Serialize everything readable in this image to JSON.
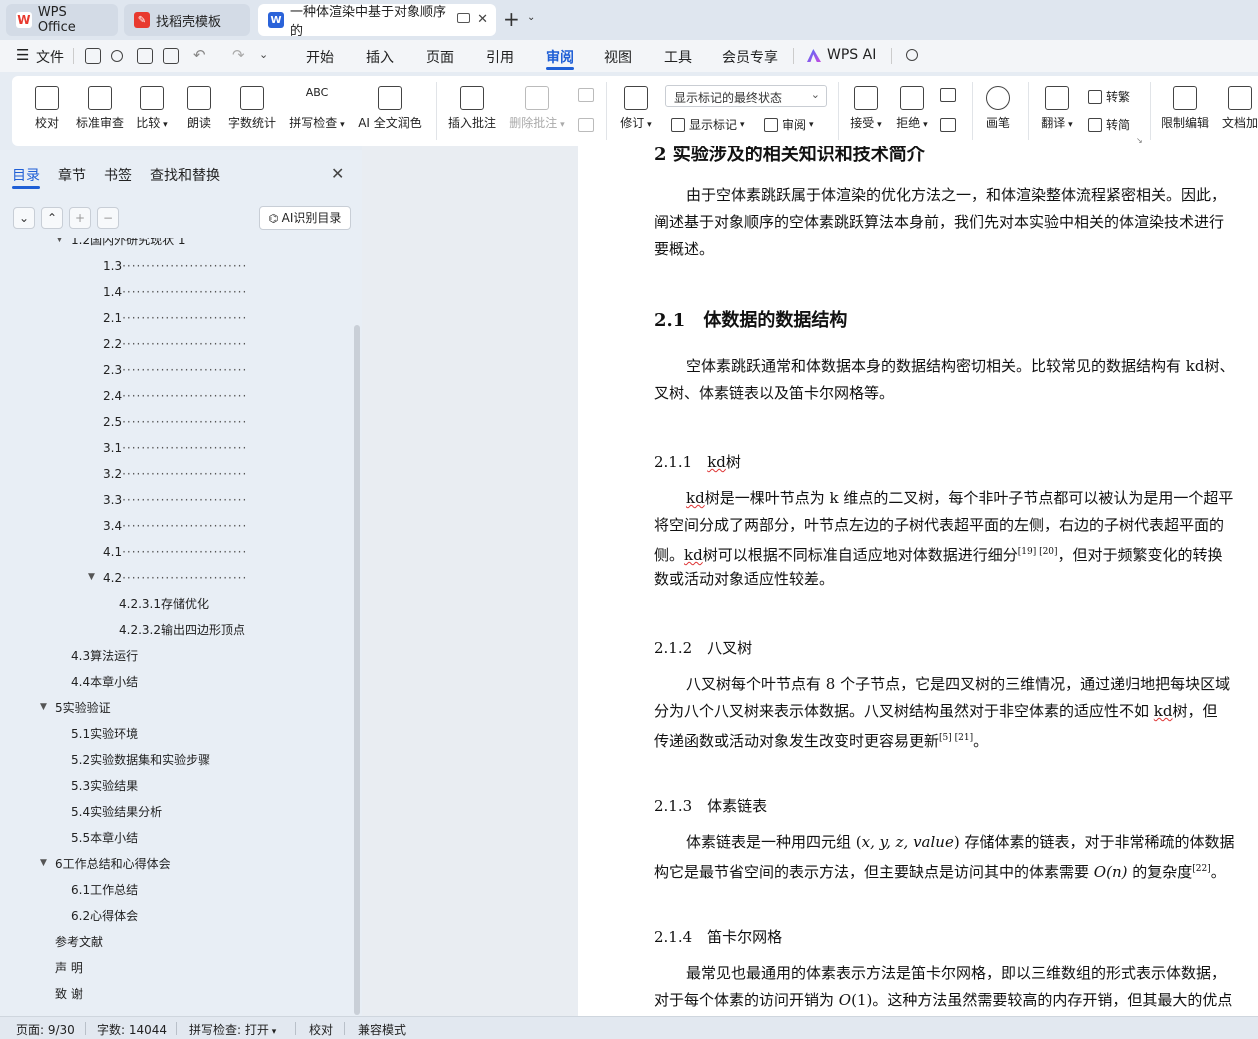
{
  "tabs": [
    {
      "label": "WPS Office",
      "icon": "wps-logo-icon",
      "color": "#e8392e"
    },
    {
      "label": "找稻壳模板",
      "icon": "docer-icon",
      "color": "#e8392e"
    },
    {
      "label": "一种体渲染中基于对象顺序的",
      "icon": "word-doc-icon",
      "color": "#2b63d9"
    }
  ],
  "new_tab": "+",
  "menu": {
    "file": "文件",
    "items": [
      "开始",
      "插入",
      "页面",
      "引用",
      "审阅",
      "视图",
      "工具",
      "会员专享"
    ],
    "active": "审阅",
    "wps_ai": "WPS AI"
  },
  "ribbon": {
    "buttons": [
      "校对",
      "标准审查",
      "比较",
      "朗读",
      "字数统计",
      "拼写检查",
      "AI 全文润色",
      "插入批注",
      "删除批注",
      "修订",
      "接受",
      "拒绝",
      "画笔",
      "翻译",
      "限制编辑",
      "文档加"
    ],
    "dropdown_value": "显示标记的最终状态",
    "show_markup": "显示标记",
    "review": "审阅",
    "to_traditional": "转繁",
    "to_simplified": "转简"
  },
  "panel": {
    "tabs": [
      "目录",
      "章节",
      "书签",
      "查找和替换"
    ],
    "active_tab": "目录",
    "ai_button": "AI识别目录"
  },
  "toc": [
    {
      "text": "1.2国内外研究现状 1",
      "level": 2,
      "arrow": true
    },
    {
      "text": "1.3",
      "level": 3,
      "dots": true
    },
    {
      "text": "1.4",
      "level": 3,
      "dots": true
    },
    {
      "text": "2.1",
      "level": 3,
      "dots": true
    },
    {
      "text": "2.2",
      "level": 3,
      "dots": true
    },
    {
      "text": "2.3",
      "level": 3,
      "dots": true
    },
    {
      "text": "2.4",
      "level": 3,
      "dots": true
    },
    {
      "text": "2.5",
      "level": 3,
      "dots": true
    },
    {
      "text": "3.1",
      "level": 3,
      "dots": true
    },
    {
      "text": "3.2",
      "level": 3,
      "dots": true
    },
    {
      "text": "3.3",
      "level": 3,
      "dots": true
    },
    {
      "text": "3.4",
      "level": 3,
      "dots": true
    },
    {
      "text": "4.1",
      "level": 3,
      "dots": true
    },
    {
      "text": "4.2",
      "level": 3,
      "dots": true,
      "arrow": true
    },
    {
      "text": "4.2.3.1存储优化",
      "level": 4
    },
    {
      "text": "4.2.3.2输出四边形顶点",
      "level": 4
    },
    {
      "text": "4.3算法运行",
      "level": 2
    },
    {
      "text": "4.4本章小结",
      "level": 2
    },
    {
      "text": "5实验验证",
      "level": 1,
      "arrow": true
    },
    {
      "text": "5.1实验环境",
      "level": 2
    },
    {
      "text": "5.2实验数据集和实验步骤",
      "level": 2
    },
    {
      "text": "5.3实验结果",
      "level": 2
    },
    {
      "text": "5.4实验结果分析",
      "level": 2
    },
    {
      "text": "5.5本章小结",
      "level": 2
    },
    {
      "text": "6工作总结和心得体会",
      "level": 1,
      "arrow": true
    },
    {
      "text": "6.1工作总结",
      "level": 2
    },
    {
      "text": "6.2心得体会",
      "level": 2
    },
    {
      "text": "参考文献",
      "level": 0
    },
    {
      "text": "声 明",
      "level": 0
    },
    {
      "text": "致 谢",
      "level": 0
    }
  ],
  "toc_leader": "··························",
  "doc": {
    "h2_top": "2 实验涉及的相关知识和技术简介",
    "p1": [
      "由于空体素跳跃属于体渲染的优化方法之一，和体渲染整体流程紧密相关。因此，",
      "阐述基于对象顺序的空体素跳跃算法本身前，我们先对本实验中相关的体渲染技术进行",
      "要概述。"
    ],
    "h21": "2.1　体数据的数据结构",
    "p2": [
      "空体素跳跃通常和体数据本身的数据结构密切相关。比较常见的数据结构有 kd树、",
      "叉树、体素链表以及笛卡尔网格等。"
    ],
    "h211_num": "2.1.1",
    "h211_kd": "kd",
    "h211_rest": "树",
    "p3a_kd": "kd",
    "p3a": "树是一棵叶节点为 k 维点的二叉树，每个非叶子节点都可以被认为是用一个超平",
    "p3b": "将空间分成了两部分，叶节点左边的子树代表超平面的左侧，右边的子树代表超平面的",
    "p3c_pre": "侧。",
    "p3c_kd": "kd",
    "p3c_mid": "树可以根据不同标准自适应地对体数据进行细分",
    "p3c_ref": "[19] [20]",
    "p3c_post": "，但对于频繁变化的转换",
    "p3d": "数或活动对象适应性较差。",
    "h212": "2.1.2　八叉树",
    "p4a": "八叉树每个叶节点有 8 个子节点，它是四叉树的三维情况，通过递归地把每块区域",
    "p4b_pre": "分为八个八叉树来表示体数据。八叉树结构虽然对于非空体素的适应性不如 ",
    "p4b_kd": "kd",
    "p4b_post": "树，但",
    "p4c": "传递函数或活动对象发生改变时更容易更新",
    "p4c_ref": "[5] [21]",
    "p4c_end": "。",
    "h213": "2.1.3　体素链表",
    "p5a_pre": "体素链表是一种用四元组 (",
    "p5a_math": "x, y, z, value",
    "p5a_post": ") 存储体素的链表，对于非常稀疏的体数据",
    "p5b_pre": "构它是最节省空间的表示方法，但主要缺点是访问其中的体素需要 ",
    "p5b_math": "O",
    "p5b_n": "(n)",
    "p5b_post": " 的复杂度",
    "p5b_ref": "[22]",
    "p5b_end": "。",
    "h214": "2.1.4　笛卡尔网格",
    "p6a": "最常见也最通用的体素表示方法是笛卡尔网格，即以三维数组的形式表示体数据，",
    "p6b_pre": "对于每个体素的访问开销为 ",
    "p6b_math": "O",
    "p6b_o1": "(1)",
    "p6b_post": "。这种方法虽然需要较高的内存开销，但其最大的优点"
  },
  "status": {
    "page": "页面: 9/30",
    "words": "字数: 14044",
    "spell": "拼写检查: 打开",
    "proof": "校对",
    "compat": "兼容模式"
  },
  "colors": {
    "accent": "#1f5fd6",
    "squiggle": "#dd3333"
  }
}
